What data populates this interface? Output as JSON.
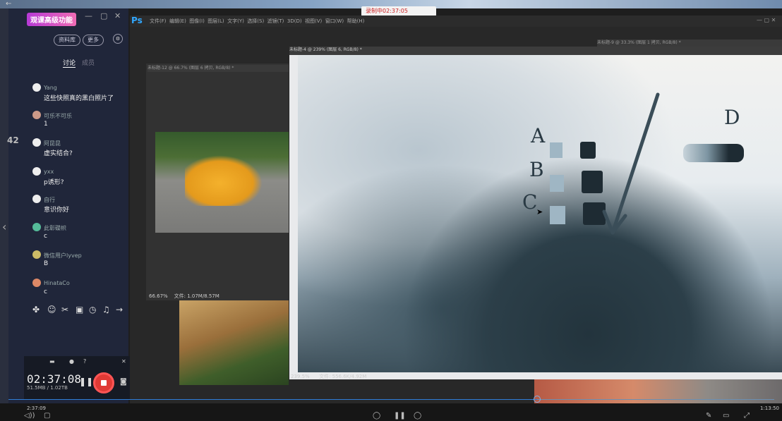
{
  "recording_indicator": "录制中02:37:05",
  "chat_panel": {
    "side_number": "42",
    "title": "观课高级功能",
    "buttons": [
      "资料库",
      "更多"
    ],
    "tabs": [
      "讨论",
      "成员"
    ],
    "messages": [
      {
        "name": "Yang",
        "text": "这些快照真的黑白照片了"
      },
      {
        "name": "可乐不可乐",
        "text": "1"
      },
      {
        "name": "阿昆昆",
        "text": "虚实结合?"
      },
      {
        "name": "yxx",
        "text": "p诱形?"
      },
      {
        "name": "自行",
        "text": "意识你好"
      },
      {
        "name": "此彰碟帜",
        "text": "c"
      },
      {
        "name": "微信用户lyvep",
        "text": "B"
      },
      {
        "name": "HinataCo",
        "text": "c"
      }
    ],
    "toolbar_icons": [
      "puzzle-icon",
      "emoji-icon",
      "scissors-icon",
      "image-icon",
      "clock-icon",
      "bell-icon",
      "arrow-right-icon"
    ]
  },
  "recorder": {
    "time": "02:37:08",
    "size": "51.5MB / 1.02TB"
  },
  "photoshop": {
    "logo": "Ps",
    "menu": [
      "文件(F)",
      "编辑(E)",
      "图像(I)",
      "图层(L)",
      "文字(Y)",
      "选择(S)",
      "滤镜(T)",
      "3D(D)",
      "视图(V)",
      "窗口(W)",
      "帮助(H)"
    ],
    "doc1": {
      "title": "未标题-12 @ 66.7% (图层 6 拷贝, RGB/8) *",
      "zoom": "66.67%",
      "status": "文件: 1.07M/8.57M"
    },
    "doc2": {
      "title": "未标题-4 @ 239% (图层 6, RGB/8) *",
      "zoom": "239.5%",
      "status": "文件: 556.6K/4.92M"
    },
    "doc3": {
      "title": "未标题-9 @ 33.3% (图层 1 拷贝, RGB/8) *"
    },
    "canvas_letters": [
      "A",
      "B",
      "C",
      "D"
    ]
  },
  "player": {
    "time_current": "2:37:09",
    "time_total": "1:13:50",
    "progress_fraction": 0.69
  }
}
